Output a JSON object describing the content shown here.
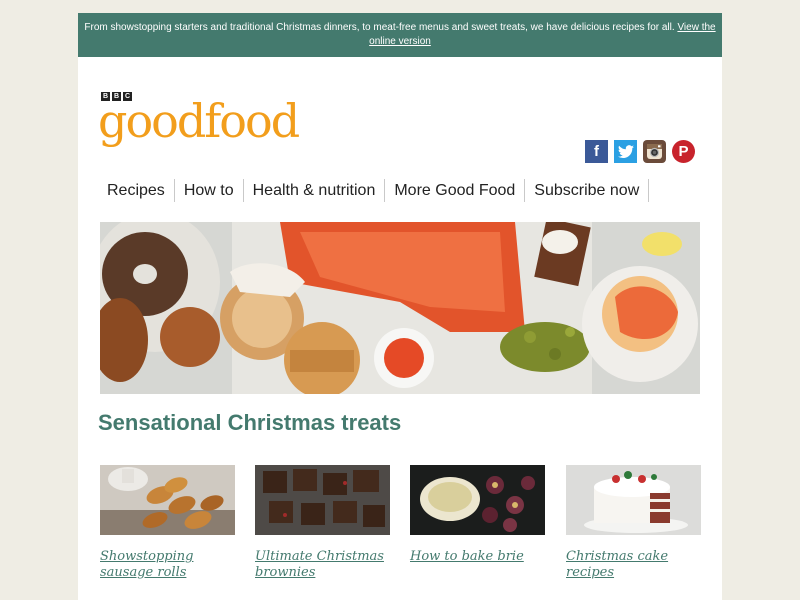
{
  "banner": {
    "text": "From showstopping starters and traditional Christmas dinners, to meat-free menus and sweet treats, we have delicious recipes for all.",
    "link": "View the online version"
  },
  "logo": {
    "bbc": [
      "B",
      "B",
      "C"
    ],
    "word": "goodfood"
  },
  "social": [
    "facebook-icon",
    "twitter-icon",
    "instagram-icon",
    "pinterest-icon"
  ],
  "nav": {
    "items": [
      {
        "label": "Recipes"
      },
      {
        "label": "How to"
      },
      {
        "label": "Health & nutrition"
      },
      {
        "label": "More Good Food"
      },
      {
        "label": "Subscribe now"
      }
    ]
  },
  "section": {
    "title": "Sensational Christmas treats"
  },
  "cards": [
    {
      "title": "Showstopping sausage rolls"
    },
    {
      "title": "Ultimate Christmas brownies"
    },
    {
      "title": "How to bake brie"
    },
    {
      "title": "Christmas cake recipes"
    }
  ],
  "colors": {
    "accent": "#447a6e",
    "logo": "#f29e1c",
    "page": "#efede4"
  }
}
